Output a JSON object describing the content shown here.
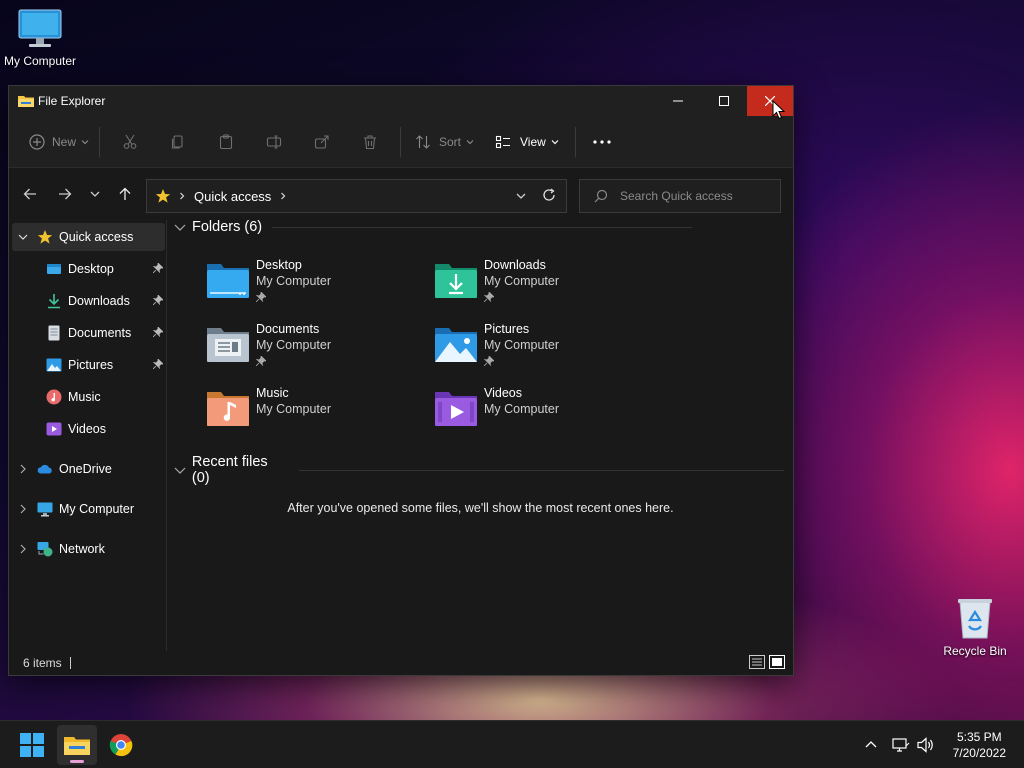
{
  "desktop": {
    "icons": [
      {
        "label": "My Computer"
      },
      {
        "label": "Recycle Bin"
      }
    ]
  },
  "window": {
    "title": "File Explorer",
    "commands": {
      "new_label": "New",
      "sort_label": "Sort",
      "view_label": "View"
    },
    "address": {
      "location": "Quick access"
    },
    "search": {
      "placeholder": "Search Quick access"
    },
    "sidebar": {
      "items": [
        {
          "label": "Quick access",
          "icon": "star-icon"
        },
        {
          "label": "Desktop",
          "icon": "desktop-folder-icon",
          "pinned": true
        },
        {
          "label": "Downloads",
          "icon": "download-icon",
          "pinned": true
        },
        {
          "label": "Documents",
          "icon": "document-icon",
          "pinned": true
        },
        {
          "label": "Pictures",
          "icon": "picture-icon",
          "pinned": true
        },
        {
          "label": "Music",
          "icon": "music-icon"
        },
        {
          "label": "Videos",
          "icon": "video-icon"
        },
        {
          "label": "OneDrive",
          "icon": "cloud-icon"
        },
        {
          "label": "My Computer",
          "icon": "computer-icon"
        },
        {
          "label": "Network",
          "icon": "network-icon"
        }
      ]
    },
    "folders_heading": "Folders (6)",
    "folders": [
      {
        "name": "Desktop",
        "location": "My Computer",
        "pinned": true
      },
      {
        "name": "Downloads",
        "location": "My Computer",
        "pinned": true
      },
      {
        "name": "Documents",
        "location": "My Computer",
        "pinned": true
      },
      {
        "name": "Pictures",
        "location": "My Computer",
        "pinned": true
      },
      {
        "name": "Music",
        "location": "My Computer",
        "pinned": false
      },
      {
        "name": "Videos",
        "location": "My Computer",
        "pinned": false
      }
    ],
    "recent_heading": "Recent files (0)",
    "recent_empty": "After you've opened some files, we'll show the most recent ones here.",
    "status": {
      "item_count": "6 items"
    }
  },
  "taskbar": {
    "clock": {
      "time": "5:35 PM",
      "date": "7/20/2022"
    }
  },
  "colors": {
    "close_button": "#c42b1c",
    "accent_folder_blue": "#1f8fd8",
    "star": "#f2c12e"
  }
}
